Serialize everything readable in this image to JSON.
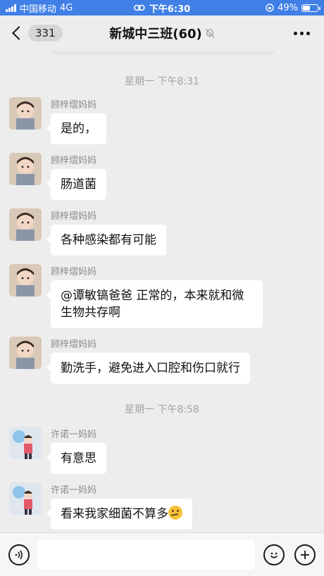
{
  "status_bar": {
    "carrier": "中国移动",
    "network": "4G",
    "time": "下午6:30",
    "battery": "49%",
    "battery_level": 0.49
  },
  "nav": {
    "unread_count": "331",
    "title": "新城中三班(60)"
  },
  "messages_groups": [
    {
      "time": "星期一 下午8:31",
      "messages": [
        {
          "sender": "顾梓熠妈妈",
          "text": "是的，"
        },
        {
          "sender": "顾梓熠妈妈",
          "text": "肠道菌"
        },
        {
          "sender": "顾梓熠妈妈",
          "text": "各种感染都有可能"
        },
        {
          "sender": "顾梓熠妈妈",
          "text": "@谭敏镐爸爸 正常的，本来就和微生物共存啊"
        },
        {
          "sender": "顾梓熠妈妈",
          "text": "勤洗手，避免进入口腔和伤口就行"
        }
      ]
    },
    {
      "time": "星期一 下午8:58",
      "messages": [
        {
          "sender": "许诺一妈妈",
          "text": "有意思"
        },
        {
          "sender": "许诺一妈妈",
          "text": "看来我家细菌不算多",
          "emoji": "thinking-face"
        }
      ]
    }
  ],
  "colors": {
    "status_bar_bg": "#3f7fe6",
    "chat_bg": "#ededed",
    "bubble_bg": "#ffffff"
  }
}
